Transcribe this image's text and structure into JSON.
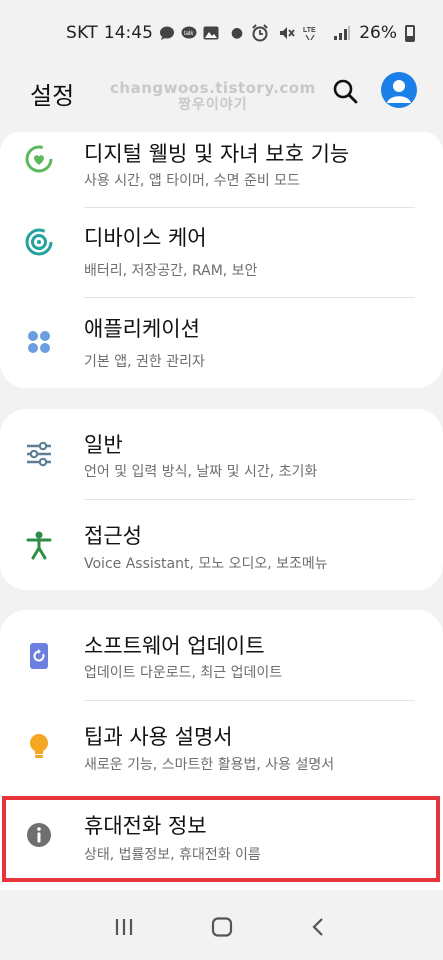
{
  "status_bar": {
    "carrier": "SKT",
    "time": "14:45",
    "lte_label": "LTE",
    "battery": "26%"
  },
  "header": {
    "title": "설정",
    "watermark_line1": "changwoos.tistory.com",
    "watermark_line2": "짱우이야기",
    "search_icon": "search-icon",
    "account_icon": "account-icon"
  },
  "groups": [
    {
      "items": [
        {
          "title": "디지털 웰빙 및 자녀 보호 기능",
          "subtitle": "사용 시간, 앱 타이머, 수면 준비 모드",
          "icon": "digital-wellbeing-icon",
          "color": "#5cb85c"
        },
        {
          "title": "디바이스 케어",
          "subtitle": "배터리, 저장공간, RAM, 보안",
          "icon": "device-care-icon",
          "color": "#23a39b"
        },
        {
          "title": "애플리케이션",
          "subtitle": "기본 앱, 권한 관리자",
          "icon": "apps-icon",
          "color": "#6a9ee0"
        }
      ]
    },
    {
      "items": [
        {
          "title": "일반",
          "subtitle": "언어 및 입력 방식, 날짜 및 시간, 초기화",
          "icon": "general-management-icon",
          "color": "#5c7f95"
        },
        {
          "title": "접근성",
          "subtitle": "Voice Assistant, 모노 오디오, 보조메뉴",
          "icon": "accessibility-icon",
          "color": "#2e8b45"
        }
      ]
    },
    {
      "items": [
        {
          "title": "소프트웨어 업데이트",
          "subtitle": "업데이트 다운로드, 최근 업데이트",
          "icon": "software-update-icon",
          "color": "#6b7fe0"
        },
        {
          "title": "팁과 사용 설명서",
          "subtitle": "새로운 기능, 스마트한 활용법, 사용 설명서",
          "icon": "tips-icon",
          "color": "#f5a623"
        },
        {
          "title": "휴대전화 정보",
          "subtitle": "상태, 법률정보, 휴대전화 이름",
          "icon": "info-icon",
          "color": "#6f6f6f",
          "highlighted": true
        }
      ]
    }
  ],
  "navigation": {
    "recents": "recents-icon",
    "home": "home-icon",
    "back": "back-icon"
  },
  "colors": {
    "background": "#f2f2f2",
    "card": "#ffffff",
    "accent": "#1a7fe6",
    "highlight": "#e8343b"
  }
}
